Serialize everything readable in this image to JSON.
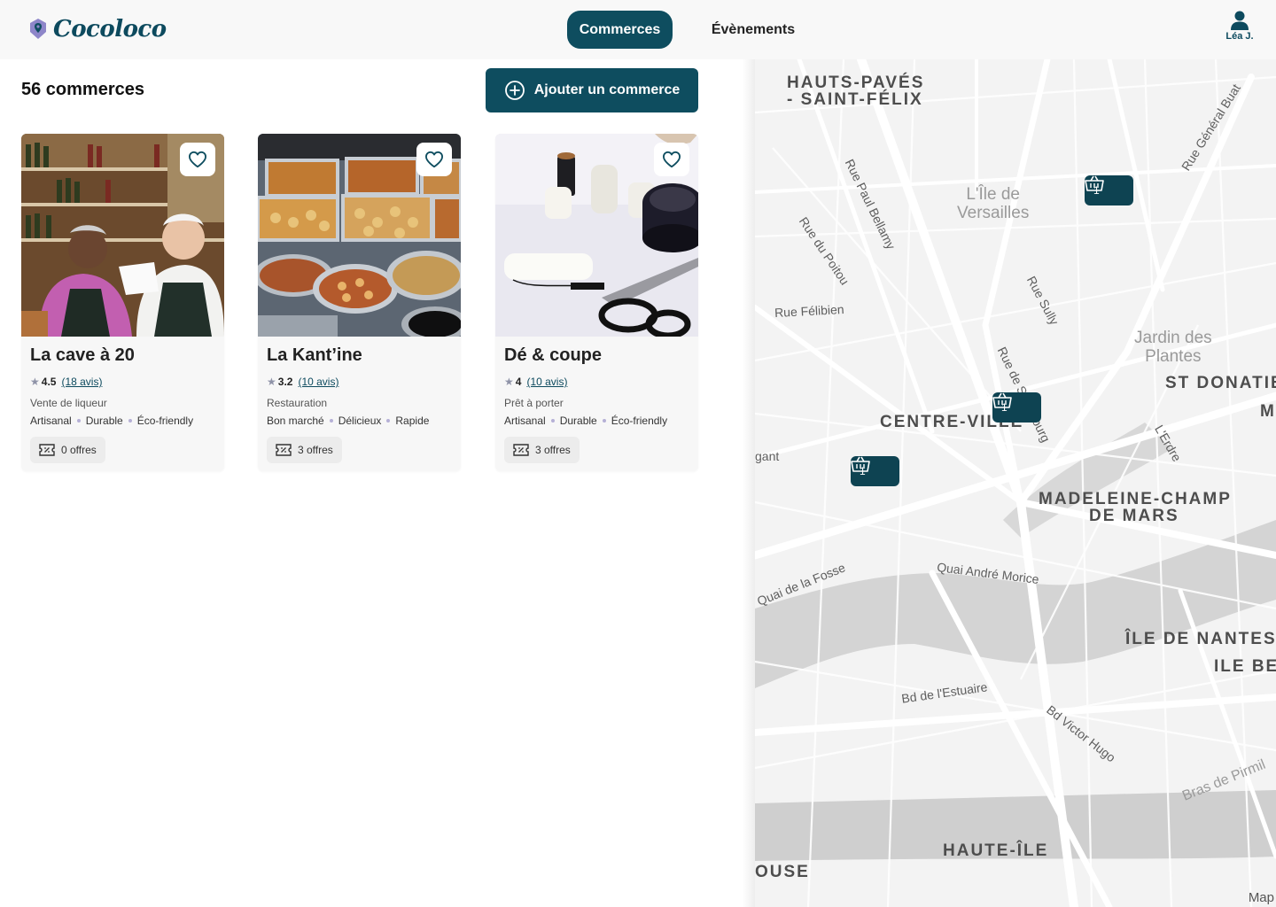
{
  "header": {
    "logo_text": "Cocoloco",
    "nav": [
      {
        "label": "Commerces",
        "active": true
      },
      {
        "label": "Évènements",
        "active": false
      }
    ],
    "user_name": "Léa J."
  },
  "list": {
    "count_label": "56 commerces",
    "add_button_label": "Ajouter un commerce"
  },
  "cards": [
    {
      "title": "La cave à 20",
      "rating": "4.5",
      "reviews": "(18 avis)",
      "category": "Vente de liqueur",
      "tags": [
        "Artisanal",
        "Durable",
        "Éco-friendly"
      ],
      "offers": "0 offres"
    },
    {
      "title": "La Kant’ine",
      "rating": "3.2",
      "reviews": "(10 avis)",
      "category": "Restauration",
      "tags": [
        "Bon marché",
        "Délicieux",
        "Rapide"
      ],
      "offers": "3 offres"
    },
    {
      "title": "Dé & coupe",
      "rating": "4",
      "reviews": "(10 avis)",
      "category": "Prêt à porter",
      "tags": [
        "Artisanal",
        "Durable",
        "Éco-friendly"
      ],
      "offers": "3 offres"
    }
  ],
  "map": {
    "districts": [
      "HAUTS-PAVÉS",
      "- SAINT-FÉLIX",
      "CENTRE-VILLE",
      "MADELEINE-CHAMP",
      "DE MARS",
      "ST DONATIE",
      "M",
      "ÎLE DE NANTES",
      "ILE BE",
      "HAUTE-ÎLE",
      "OUSE"
    ],
    "streets": [
      "Rue Paul Bellamy",
      "Rue du Poitou",
      "Rue Félibien",
      "Rue Sully",
      "Rue de Strasbourg",
      "Rue Général Buat",
      "L'Erdre",
      "Quai de la Fosse",
      "Quai André Morice",
      "Bd de l'Estuaire",
      "Bd Victor Hugo",
      "Bras de Pirmil",
      "gant"
    ],
    "parks": [
      "L'Île de",
      "Versailles",
      "Jardin des",
      "Plantes"
    ],
    "markers": [
      {
        "count": "1"
      },
      {
        "count": "1"
      },
      {
        "count": "1"
      }
    ],
    "attribution": "Map"
  },
  "colors": {
    "primary": "#0e4d5f",
    "marker": "#0e4352",
    "card_bg": "#f7f7f7",
    "tag_dot": "#b5b0d6"
  }
}
